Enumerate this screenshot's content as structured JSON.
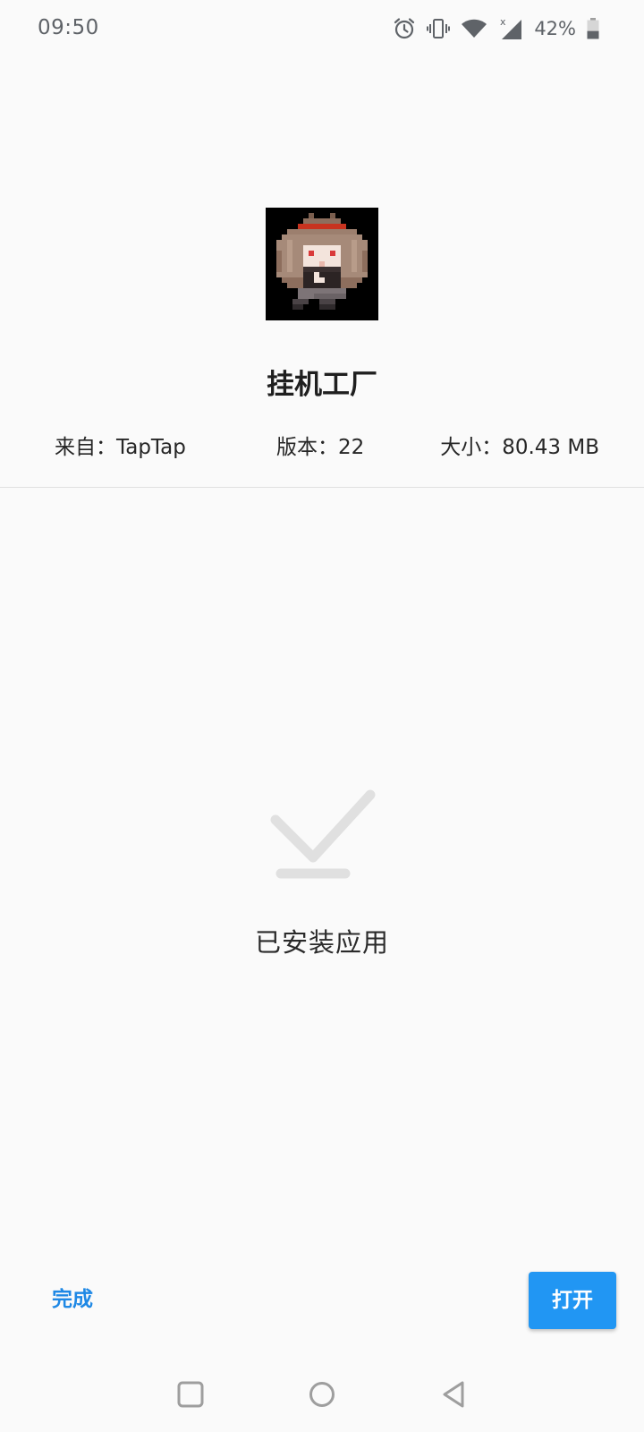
{
  "status_bar": {
    "time": "09:50",
    "battery_percent": "42%",
    "battery_level": 0.42,
    "icons": [
      "alarm-icon",
      "vibrate-icon",
      "wifi-icon",
      "cellular-no-signal-icon",
      "battery-icon"
    ]
  },
  "app": {
    "icon": "pixel-character-app-icon",
    "name": "挂机工厂",
    "source": "来自：TapTap",
    "version": "版本：22",
    "size": "大小：80.43 MB"
  },
  "result": {
    "icon": "checkmark-icon",
    "message": "已安装应用"
  },
  "actions": {
    "done_label": "完成",
    "open_label": "打开"
  },
  "colors": {
    "accent": "#2196f3",
    "done_text": "#1e88e5",
    "background": "#fafafa",
    "check_mark": "#e0e0e0"
  },
  "nav_bar": {
    "icons": [
      "recent-apps-icon",
      "home-icon",
      "back-icon"
    ]
  }
}
